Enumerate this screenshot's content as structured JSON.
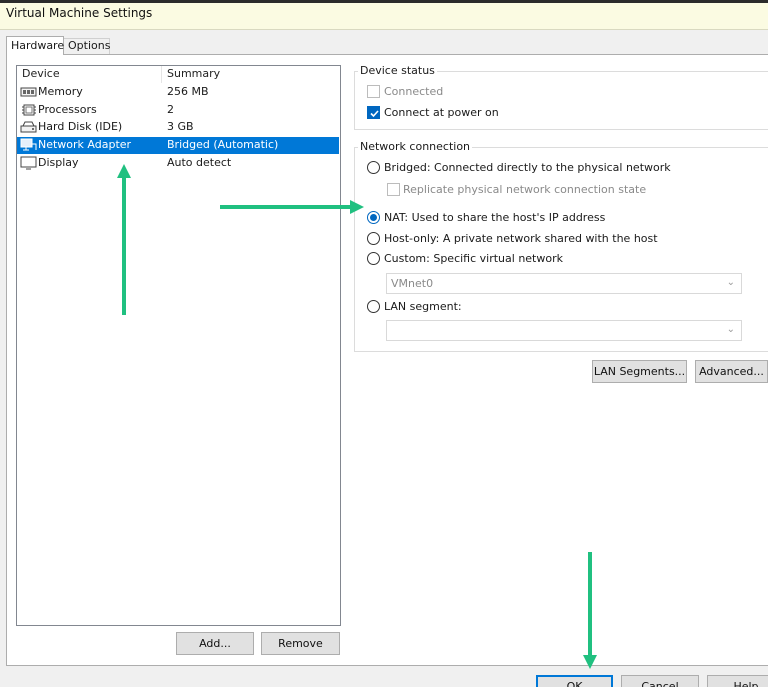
{
  "window": {
    "title": "Virtual Machine Settings"
  },
  "tabs": [
    {
      "label": "Hardware",
      "active": true
    },
    {
      "label": "Options",
      "active": false
    }
  ],
  "device_list": {
    "headers": {
      "device": "Device",
      "summary": "Summary"
    },
    "rows": [
      {
        "device": "Memory",
        "summary": "256 MB",
        "icon": "memory-icon",
        "selected": false
      },
      {
        "device": "Processors",
        "summary": "2",
        "icon": "processor-icon",
        "selected": false
      },
      {
        "device": "Hard Disk (IDE)",
        "summary": "3 GB",
        "icon": "hard-disk-icon",
        "selected": false
      },
      {
        "device": "Network Adapter",
        "summary": "Bridged (Automatic)",
        "icon": "network-adapter-icon",
        "selected": true
      },
      {
        "device": "Display",
        "summary": "Auto detect",
        "icon": "display-icon",
        "selected": false
      }
    ],
    "add_label": "Add...",
    "remove_label": "Remove"
  },
  "device_status": {
    "title": "Device status",
    "connected_label": "Connected",
    "connected_checked": false,
    "connect_power_label": "Connect at power on",
    "connect_power_checked": true
  },
  "network_connection": {
    "title": "Network connection",
    "bridged_label": "Bridged: Connected directly to the physical network",
    "replicate_label": "Replicate physical network connection state",
    "nat_label": "NAT: Used to share the host's IP address",
    "hostonly_label": "Host-only: A private network shared with the host",
    "custom_label": "Custom: Specific virtual network",
    "custom_select_value": "VMnet0",
    "lan_label": "LAN segment:",
    "lan_select_value": "",
    "selected": "nat"
  },
  "buttons": {
    "lan_segments": "LAN Segments...",
    "advanced": "Advanced...",
    "ok": "OK",
    "cancel": "Cancel",
    "help": "Help"
  },
  "colors": {
    "selection": "#0078d7",
    "annotation_arrow": "#20c080",
    "title_bar": "#fbfbe2"
  }
}
